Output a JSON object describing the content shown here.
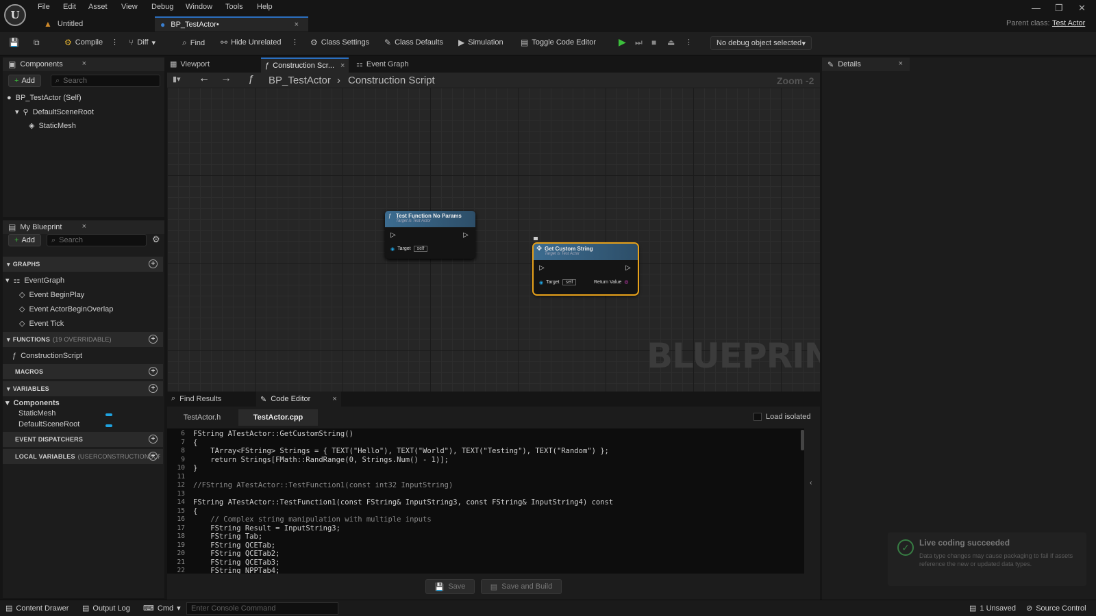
{
  "app": {
    "logo": "U",
    "menus": [
      "File",
      "Edit",
      "Asset",
      "View",
      "Debug",
      "Window",
      "Tools",
      "Help"
    ]
  },
  "doc_tabs": {
    "untitled": "Untitled",
    "bp": "BP_TestActor•"
  },
  "parent_class": {
    "label": "Parent class:",
    "value": "Test Actor"
  },
  "toolbar": {
    "compile": "Compile",
    "diff": "Diff",
    "find": "Find",
    "hide_unrelated": "Hide Unrelated",
    "class_settings": "Class Settings",
    "class_defaults": "Class Defaults",
    "simulation": "Simulation",
    "toggle_code_editor": "Toggle Code Editor",
    "debug_object": "No debug object selected"
  },
  "components_panel": {
    "title": "Components",
    "add": "Add",
    "search_placeholder": "Search",
    "items": [
      "BP_TestActor (Self)",
      "DefaultSceneRoot",
      "StaticMesh"
    ]
  },
  "my_blueprint": {
    "title": "My Blueprint",
    "add": "Add",
    "search_placeholder": "Search",
    "graphs_header": "GRAPHS",
    "event_graph": "EventGraph",
    "events": [
      "Event BeginPlay",
      "Event ActorBeginOverlap",
      "Event Tick"
    ],
    "functions_header": "FUNCTIONS",
    "functions_note": "(19 OVERRIDABLE)",
    "construction_script": "ConstructionScript",
    "macros_header": "MACROS",
    "variables_header": "VARIABLES",
    "components_group": "Components",
    "variables": [
      "StaticMesh",
      "DefaultSceneRoot"
    ],
    "event_dispatchers_header": "EVENT DISPATCHERS",
    "local_variables_header": "LOCAL VARIABLES",
    "local_variables_note": "(USERCONSTRUCTIONSCRI"
  },
  "editor_tabs": [
    "Viewport",
    "Construction Scr...",
    "Event Graph"
  ],
  "breadcrumb": {
    "root": "BP_TestActor",
    "current": "Construction Script",
    "zoom": "Zoom -2"
  },
  "watermark": "BLUEPRINT",
  "nodes": [
    {
      "title": "Test Function No Params",
      "subtitle": "Target is Test Actor",
      "target": "Target",
      "self": "self"
    },
    {
      "title": "Get Custom String",
      "subtitle": "Target is Test Actor",
      "target": "Target",
      "self": "self",
      "return": "Return Value"
    }
  ],
  "bottom_tabs": {
    "find_results": "Find Results",
    "code_editor": "Code Editor"
  },
  "file_tabs": [
    "TestActor.h",
    "TestActor.cpp"
  ],
  "load_isolated": "Load isolated",
  "code_lines": [
    {
      "n": "6",
      "t": "FString ATestActor::GetCustomString()"
    },
    {
      "n": "7",
      "t": "{"
    },
    {
      "n": "8",
      "t": "    TArray<FString> Strings = { TEXT(\"Hello\"), TEXT(\"World\"), TEXT(\"Testing\"), TEXT(\"Random\") };"
    },
    {
      "n": "9",
      "t": "    return Strings[FMath::RandRange(0, Strings.Num() - 1)];"
    },
    {
      "n": "10",
      "t": "}"
    },
    {
      "n": "11",
      "t": ""
    },
    {
      "n": "12",
      "t": "//FString ATestActor::TestFunction1(const int32 InputString)"
    },
    {
      "n": "13",
      "t": ""
    },
    {
      "n": "14",
      "t": "FString ATestActor::TestFunction1(const FString& InputString3, const FString& InputString4) const"
    },
    {
      "n": "15",
      "t": "{"
    },
    {
      "n": "16",
      "t": "    // Complex string manipulation with multiple inputs"
    },
    {
      "n": "17",
      "t": "    FString Result = InputString3;"
    },
    {
      "n": "18",
      "t": "    FString Tab;"
    },
    {
      "n": "19",
      "t": "    FString QCETab;"
    },
    {
      "n": "20",
      "t": "    FString QCETab2;"
    },
    {
      "n": "21",
      "t": "    FString QCETab3;"
    },
    {
      "n": "22",
      "t": "    FString NPPTab4;"
    }
  ],
  "buttons": {
    "save": "Save",
    "save_build": "Save and Build"
  },
  "details": {
    "title": "Details"
  },
  "toast": {
    "title": "Live coding succeeded",
    "body": "Data type changes may cause packaging to fail if assets reference the new or updated data types."
  },
  "statusbar": {
    "content_drawer": "Content Drawer",
    "output_log": "Output Log",
    "cmd": "Cmd",
    "console_placeholder": "Enter Console Command",
    "unsaved": "1 Unsaved",
    "source_control": "Source Control"
  },
  "colors": {
    "accent": "#2b6fc0",
    "node_header": "#3c6c90",
    "selected_node": "#e8a21a",
    "var_pill": "#1fa3e0",
    "play": "#3cbf3c"
  }
}
